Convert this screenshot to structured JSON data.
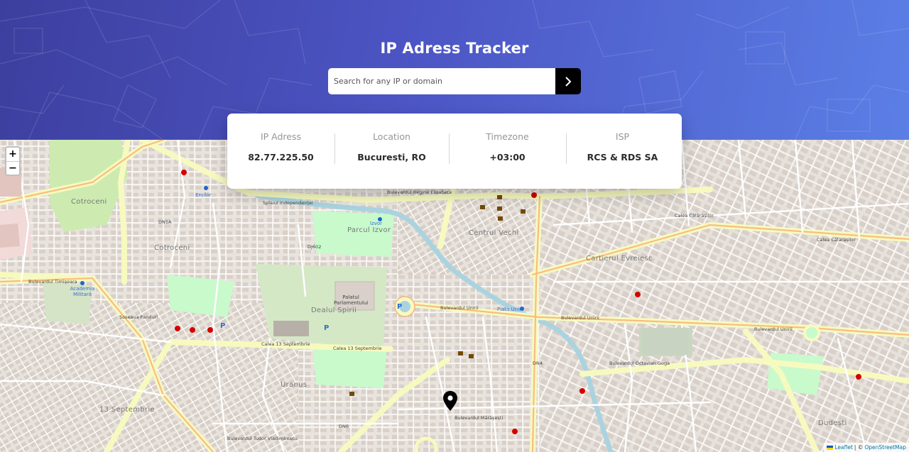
{
  "header": {
    "title": "IP Adress Tracker",
    "search_placeholder": "Search for any IP or domain",
    "search_value": "",
    "submit_icon": "chevron-right-icon"
  },
  "info": [
    {
      "label": "IP Adress",
      "value": "82.77.225.50"
    },
    {
      "label": "Location",
      "value": "Bucuresti, RO"
    },
    {
      "label": "Timezone",
      "value": "+03:00"
    },
    {
      "label": "ISP",
      "value": "RCS & RDS SA"
    }
  ],
  "map": {
    "zoom_in": "+",
    "zoom_out": "−",
    "marker_icon": "location-pin-icon",
    "labels": {
      "cotroceni": "Cotroceni",
      "centrul_vechi": "Centrul Vechi",
      "cartierul_evreiesc": "Cartierul Evreiesc",
      "dealul_spirii": "Dealul Spirii",
      "parcul_izvor": "Parcul Izvor",
      "uranus": "Uranus",
      "sept13": "13 Septembrie",
      "dudesti": "Dudești",
      "bd_unirii_1": "Bulevardul Unirii",
      "bd_unirii_2": "Bulevardul Unirii",
      "bd_unirii_3": "Bulevardul Unirii",
      "calea_13": "Calea 13 Septembrie",
      "calea_13b": "Calea 13 Septembrie",
      "regina": "Bulevardul Regina Elisabeta",
      "calarasilor": "Calea Călărașilor",
      "calarasilor_2": "Calea Călărașilor",
      "independentei": "Splaiul Independenței",
      "piata_unirii": "Piata Unirii",
      "dn1a": "DN1A",
      "dj602": "DJ602",
      "dn4": "DN4",
      "dn6": "DN6",
      "izvor": "Izvor",
      "academia": "Academia Militară",
      "eroilor": "Eroilor",
      "palatul": "Palatul Parlamentului",
      "sos_panduri": "Șoseaua Panduri",
      "tudor": "Bulevardul Tudor Vladimirescu",
      "marasesti": "Bulevardul Mărășești",
      "octavian_goga": "Bulevardul Octavian Goga",
      "timisoara": "Bulevardul Timișoara",
      "p1": "P",
      "p2": "P",
      "p3": "P"
    },
    "attribution": {
      "leaflet": "Leaflet",
      "separator": "| ©",
      "osm": "OpenStreetMap"
    }
  },
  "colors": {
    "header_start": "#3d3f9e",
    "header_end": "#5b7fe6",
    "card_bg": "#ffffff",
    "label_gray": "#959595",
    "value_dark": "#2b2b2b",
    "button_black": "#000000"
  }
}
